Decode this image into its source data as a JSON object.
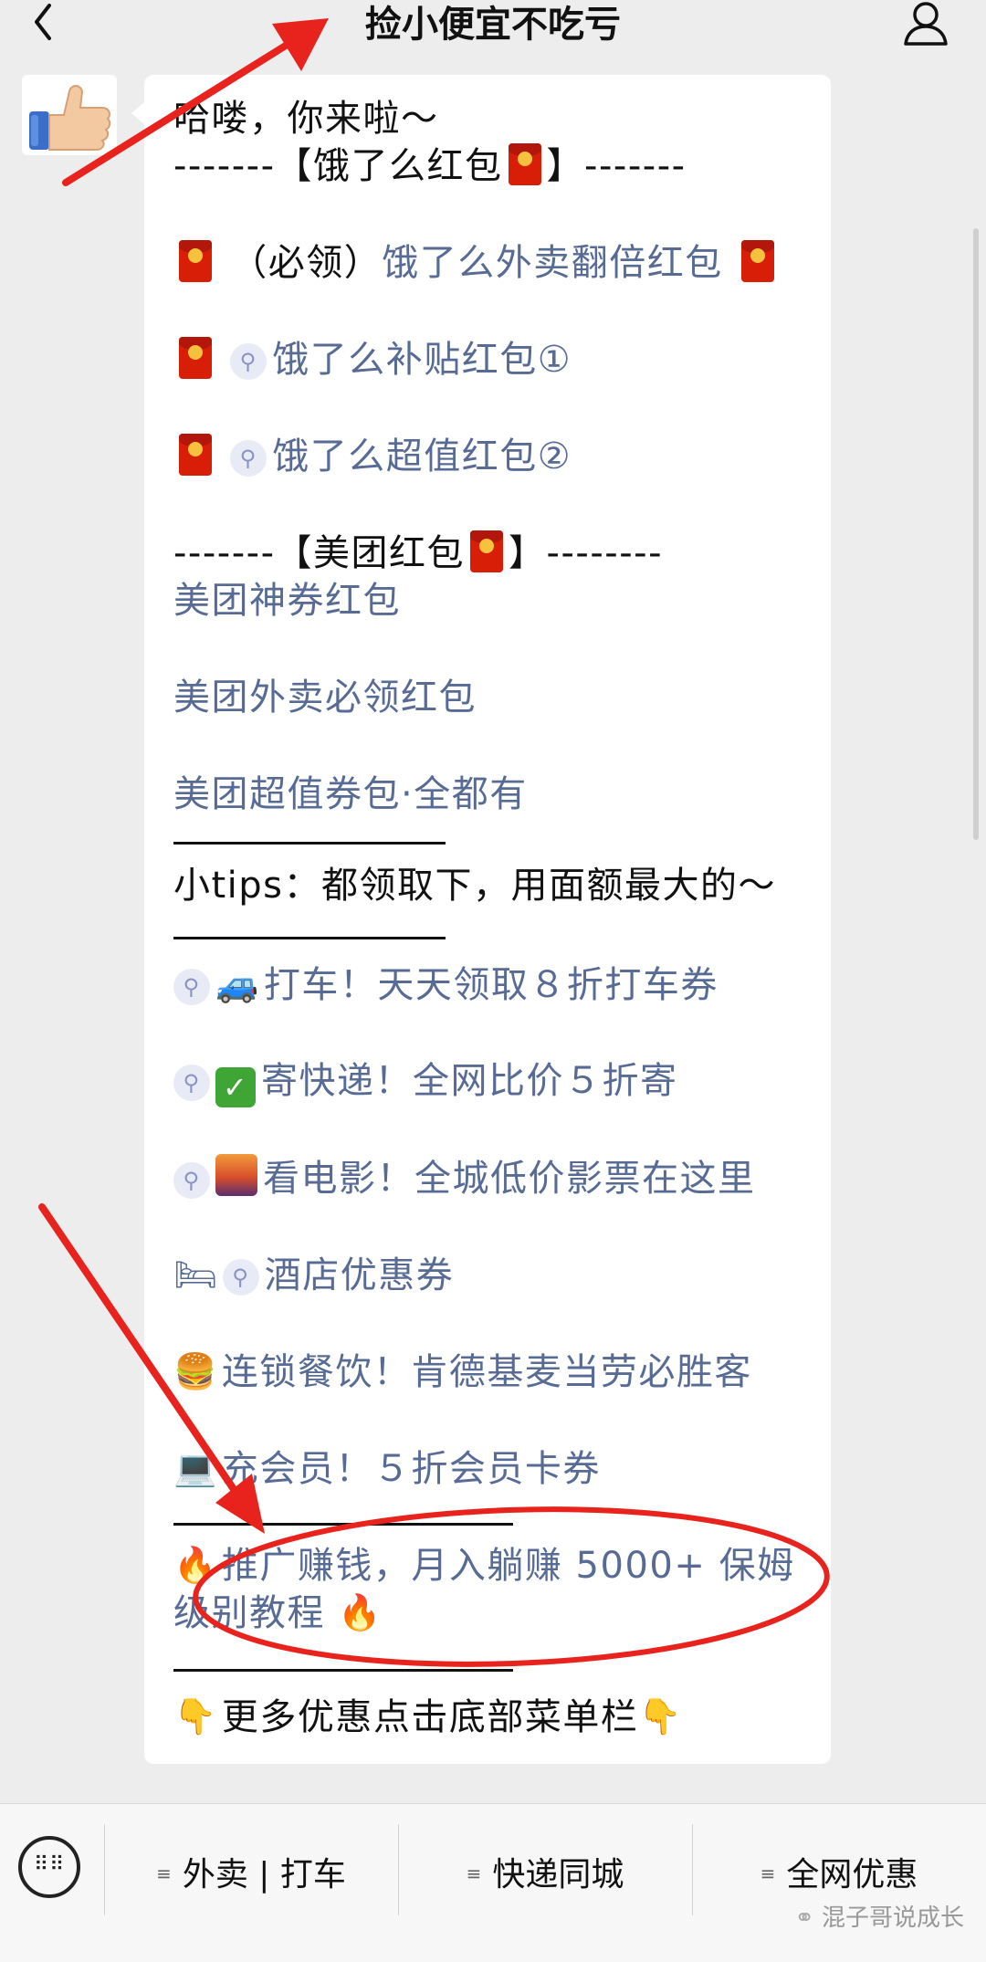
{
  "header": {
    "title": "捡小便宜不吃亏"
  },
  "message": {
    "greeting": "哈喽，你来啦～",
    "ele_section": {
      "prefix": "-------【饿了么红包",
      "suffix": "】-------"
    },
    "ele_required": {
      "label": "（必领）",
      "link": "饿了么外卖翻倍红包"
    },
    "ele_link_1": "饿了么补贴红包①",
    "ele_link_2": "饿了么超值红包②",
    "meituan_section": {
      "prefix": "-------【美团红包",
      "suffix": "】--------"
    },
    "meituan_links": [
      "美团神券红包",
      "美团外卖必领红包",
      "美团超值券包·全都有"
    ],
    "tips": "小tips：都领取下，用面额最大的～",
    "taxi": "打车！天天领取８折打车券",
    "express": "寄快递！全网比价５折寄",
    "movie": "看电影！全城低价影票在这里",
    "hotel": "酒店优惠券",
    "dining": "连锁餐饮！肯德基麦当劳必胜客",
    "membership": "充会员！５折会员卡券",
    "promo_line1": "推广赚钱，月入躺赚 5000+ 保姆",
    "promo_line2": "级别教程",
    "footer_note": "更多优惠点击底部菜单栏",
    "icons": [
      "red-envelope-icon",
      "link-icon",
      "car-icon",
      "check-icon",
      "cityscape-icon",
      "bed-icon",
      "burger-icon",
      "laptop-icon",
      "fire-icon",
      "point-down-icon"
    ]
  },
  "menu": {
    "items": [
      "外卖 | 打车",
      "快递同城",
      "全网优惠"
    ]
  },
  "watermark": "混子哥说成长",
  "colors": {
    "link": "#576b95",
    "annotation": "#e8231d",
    "envelope": "#d81e06",
    "background": "#ededed"
  }
}
